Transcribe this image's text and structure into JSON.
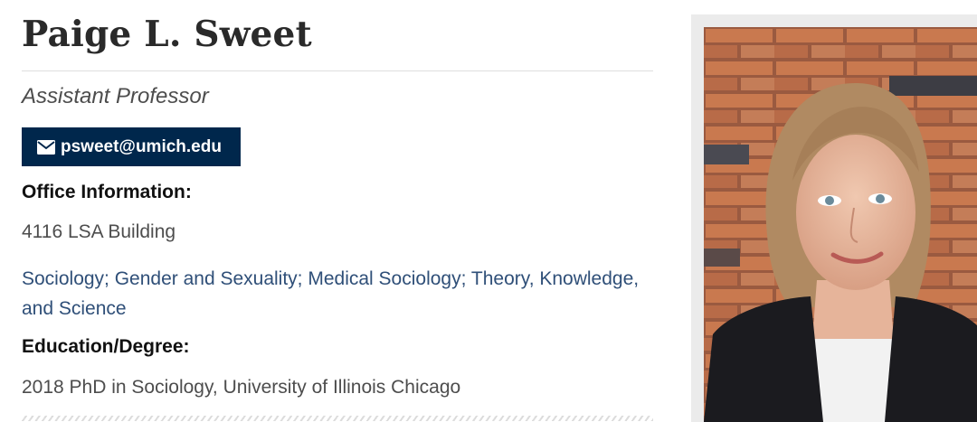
{
  "profile": {
    "name": "Paige L. Sweet",
    "title": "Assistant Professor",
    "email": "psweet@umich.edu",
    "email_icon": "envelope-icon",
    "office_label": "Office Information:",
    "office_value": "4116 LSA Building",
    "areas": "Sociology; Gender and Sexuality; Medical Sociology; Theory, Knowledge, and Science",
    "education_label": "Education/Degree:",
    "education_value": "2018 PhD in Sociology, University of Illinois Chicago"
  },
  "colors": {
    "brand_navy": "#00274c",
    "link_blue": "#2f4f78",
    "text_gray": "#4d4d4d",
    "heading": "#2a2a2a"
  }
}
